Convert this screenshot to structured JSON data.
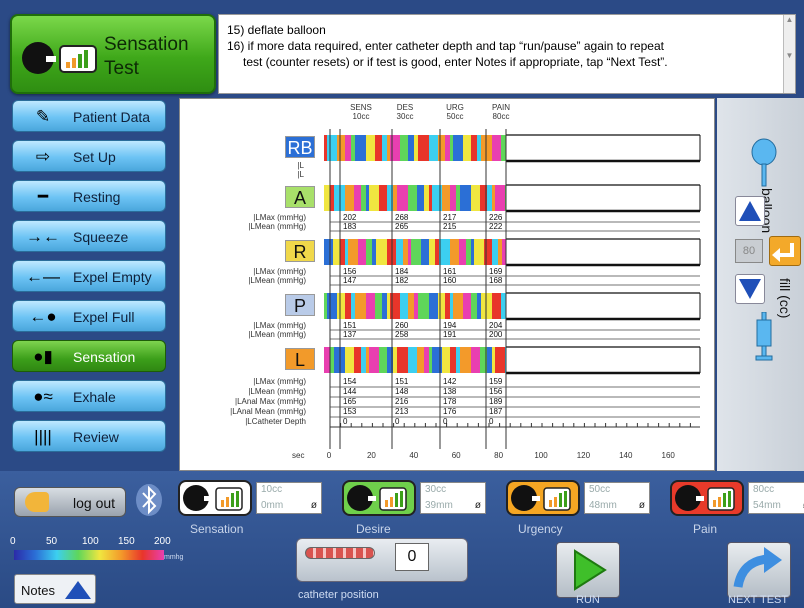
{
  "header": {
    "title_line1": "Sensation",
    "title_line2": "Test",
    "instructions": [
      "15) deflate balloon",
      "16) if more data required, enter catheter depth and tap “run/pause” again to repeat",
      "test (counter resets) or if test is good, enter Notes if appropriate, tap “Next Test”."
    ]
  },
  "sidebar": {
    "items": [
      {
        "label": "Patient Data",
        "icon": "cuff-icon",
        "active": false
      },
      {
        "label": "Set Up",
        "icon": "arrows-icon",
        "active": false
      },
      {
        "label": "Resting",
        "icon": "dash-icon",
        "active": false
      },
      {
        "label": "Squeeze",
        "icon": "squeeze-arrows-icon",
        "active": false
      },
      {
        "label": "Expel Empty",
        "icon": "left-arrow-icon",
        "active": false
      },
      {
        "label": "Expel Full",
        "icon": "left-arrow-circle-icon",
        "active": false
      },
      {
        "label": "Sensation",
        "icon": "head-chart-icon",
        "active": true
      },
      {
        "label": "Exhale",
        "icon": "exhale-icon",
        "active": false
      },
      {
        "label": "Review",
        "icon": "review-icon",
        "active": false
      }
    ]
  },
  "plot": {
    "phases": [
      {
        "name": "SENS",
        "volume": "10cc"
      },
      {
        "name": "DES",
        "volume": "30cc"
      },
      {
        "name": "URG",
        "volume": "50cc"
      },
      {
        "name": "PAIN",
        "volume": "80cc"
      }
    ],
    "rows": [
      {
        "letter": "RB",
        "color": "#2b6fd6"
      },
      {
        "letter": "A",
        "color": "#a8e06a"
      },
      {
        "letter": "R",
        "color": "#f0d84a"
      },
      {
        "letter": "P",
        "color": "#b9cbe8"
      },
      {
        "letter": "L",
        "color": "#f29a2a"
      }
    ],
    "l_markers": [
      "|L",
      "|L"
    ],
    "stats": [
      {
        "labels": [
          "|LMax (mmHg)",
          "|LMean (mmHg)"
        ],
        "values": [
          [
            "202",
            "183"
          ],
          [
            "268",
            "265"
          ],
          [
            "217",
            "215"
          ],
          [
            "226",
            "222"
          ]
        ]
      },
      {
        "labels": [
          "|LMax (mmHg)",
          "|LMean (mmHg)"
        ],
        "values": [
          [
            "156",
            "147"
          ],
          [
            "184",
            "182"
          ],
          [
            "161",
            "160"
          ],
          [
            "169",
            "168"
          ]
        ]
      },
      {
        "labels": [
          "|LMax (mmHg)",
          "|LMean (mmHg)"
        ],
        "values": [
          [
            "151",
            "137"
          ],
          [
            "260",
            "258"
          ],
          [
            "194",
            "191"
          ],
          [
            "204",
            "200"
          ]
        ]
      }
    ],
    "final_labels": [
      "|LMax (mmHg)",
      "|LMean (mmHg)",
      "|LAnal Max (mmHg)",
      "|LAnal Mean (mmHg)",
      "|LCatheter Depth"
    ],
    "final_values": [
      [
        "154",
        "144",
        "165",
        "153"
      ],
      [
        "151",
        "148",
        "216",
        "213"
      ],
      [
        "142",
        "138",
        "178",
        "176"
      ],
      [
        "159",
        "156",
        "189",
        "187"
      ]
    ],
    "depth_values": [
      "0",
      "0",
      "0",
      "0"
    ],
    "x_axis_label": "sec",
    "x_ticks": [
      "0",
      "20",
      "40",
      "60",
      "80",
      "100",
      "120",
      "140",
      "160"
    ]
  },
  "right_panel": {
    "balloon_label": "balloon",
    "fill_label": "fill (cc)",
    "fill_value": "80"
  },
  "bottom": {
    "logout_label": "log out",
    "cards": [
      {
        "label": "Sensation",
        "cc": "10cc",
        "mm": "0mm",
        "color": "#ffffff"
      },
      {
        "label": "Desire",
        "cc": "30cc",
        "mm": "39mm",
        "color": "#6fd04b"
      },
      {
        "label": "Urgency",
        "cc": "50cc",
        "mm": "48mm",
        "color": "#f5a623"
      },
      {
        "label": "Pain",
        "cc": "80cc",
        "mm": "54mm",
        "color": "#e83a2a"
      }
    ],
    "null_symbol": "ø",
    "scale_ticks": [
      "0",
      "50",
      "100",
      "150",
      "200"
    ],
    "scale_unit": "mmhg",
    "notes_label": "Notes",
    "catheter_label": "catheter position",
    "catheter_value": "0",
    "run_label": "RUN",
    "next_label": "NEXT TEST"
  }
}
